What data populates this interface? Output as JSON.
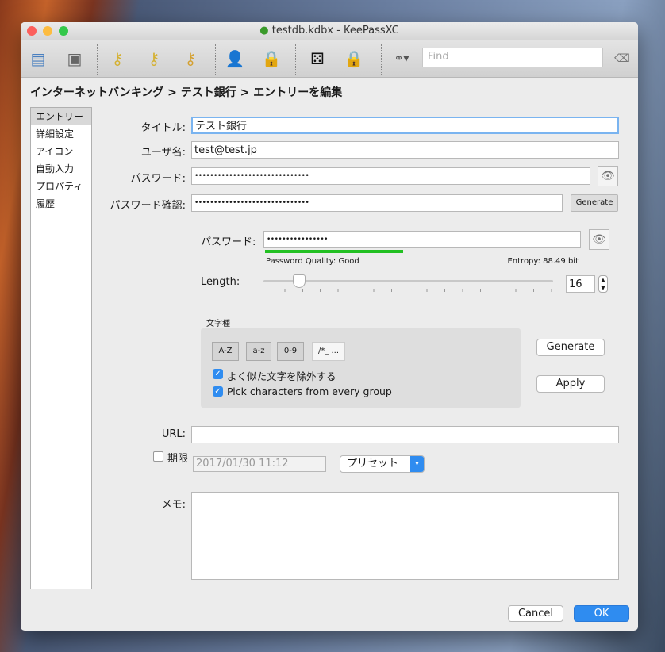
{
  "window": {
    "title": "testdb.kdbx - KeePassXC"
  },
  "toolbar": {
    "find_placeholder": "Find",
    "icons": [
      "new-database-icon",
      "save-icon",
      "add-entry-icon",
      "edit-entry-icon",
      "delete-entry-icon",
      "copy-username-icon",
      "copy-password-icon",
      "password-generator-icon",
      "lock-icon",
      "search-icon",
      "clear-search-icon"
    ]
  },
  "breadcrumb": "インターネットバンキング > テスト銀行 > エントリーを編集",
  "sidebar": {
    "items": [
      {
        "label": "エントリー"
      },
      {
        "label": "詳細設定"
      },
      {
        "label": "アイコン"
      },
      {
        "label": "自動入力"
      },
      {
        "label": "プロパティ"
      },
      {
        "label": "履歴"
      }
    ]
  },
  "form": {
    "title_label": "タイトル:",
    "title_value": "テスト銀行",
    "username_label": "ユーザ名:",
    "username_value": "test@test.jp",
    "password_label": "パスワード:",
    "password_value": "••••••••••••••••••••••••••••••",
    "repeat_label": "パスワード確認:",
    "repeat_value": "••••••••••••••••••••••••••••••",
    "generate_label": "Generate",
    "url_label": "URL:",
    "url_value": "",
    "expires_label": "期限",
    "expires_checked": false,
    "expires_value": "2017/01/30 11:12",
    "presets_label": "プリセット",
    "notes_label": "メモ:",
    "notes_value": ""
  },
  "generator": {
    "password_label": "パスワード:",
    "password_value": "••••••••••••••••",
    "quality_fraction": 0.5,
    "quality_label": "Password Quality: Good",
    "entropy_label": "Entropy: 88.49 bit",
    "length_label": "Length:",
    "length_value": "16",
    "charset_title": "文字種",
    "charset_buttons": [
      "A-Z",
      "a-z",
      "0-9",
      "/*_ ..."
    ],
    "exclude_label": "よく似た文字を除外する",
    "exclude_checked": true,
    "every_group_label": "Pick characters from every group",
    "every_group_checked": true,
    "generate_label": "Generate",
    "apply_label": "Apply"
  },
  "footer": {
    "cancel_label": "Cancel",
    "ok_label": "OK"
  },
  "colors": {
    "accent": "#2f8cf0",
    "quality": "#22c022"
  }
}
